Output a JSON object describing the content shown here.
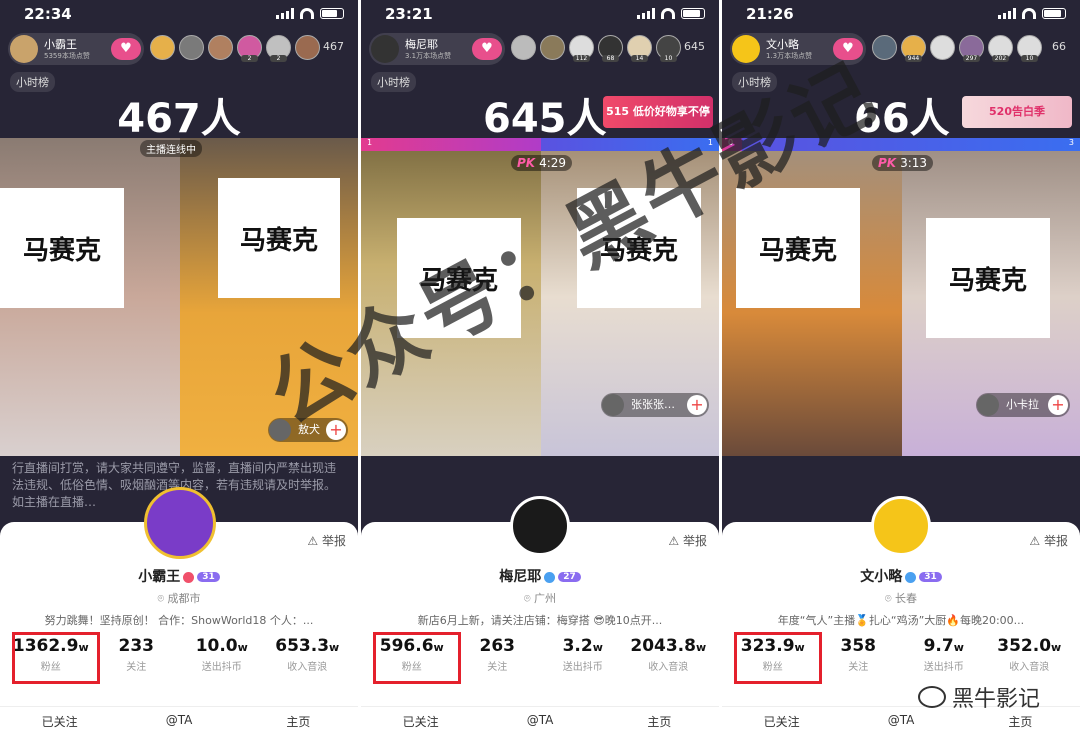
{
  "panels": [
    {
      "time": "22:34",
      "host_name": "小霸王",
      "host_sub": "5359本场点赞",
      "viewer_badges": [
        "",
        "",
        "",
        "2",
        "2",
        ""
      ],
      "viewer_count": "467",
      "rank_label": "小时榜",
      "online": "467人",
      "live_tag": "主播连线中",
      "banner": "",
      "pk_left": "",
      "pk_right": "",
      "pk_time": "",
      "mosaics": [
        "马赛克",
        "马赛克"
      ],
      "guest_name": "敖犬",
      "notice": "行直播间打赏，请大家共同遵守，监督，直播间内严禁出现违法违规、低俗色情、吸烟酗酒等内容，若有违规请及时举报。如主播在直播…",
      "name": "小霸王",
      "level": "31",
      "city": "成都市",
      "bio": "努力跳舞！坚持原创！ 合作：ShowWorld18 个人：...",
      "stats": [
        {
          "num": "1362.9",
          "unit": "w",
          "label": "粉丝"
        },
        {
          "num": "233",
          "unit": "",
          "label": "关注"
        },
        {
          "num": "10.0",
          "unit": "w",
          "label": "送出抖币"
        },
        {
          "num": "653.3",
          "unit": "w",
          "label": "收入音浪"
        }
      ],
      "actions": [
        "已关注",
        "@TA",
        "主页"
      ],
      "report": "举报"
    },
    {
      "time": "23:21",
      "host_name": "梅尼耶",
      "host_sub": "3.1万本场点赞",
      "viewer_badges": [
        "",
        "",
        "112",
        "68",
        "14",
        "10"
      ],
      "viewer_count": "645",
      "rank_label": "小时榜",
      "online": "645人",
      "live_tag": "",
      "banner": "515 低价好物享不停",
      "pk_left": "1",
      "pk_right": "1",
      "pk_time": "4:29",
      "mosaics": [
        "马赛克",
        "马赛克"
      ],
      "guest_name": "张张张…",
      "notice": "",
      "name": "梅尼耶",
      "level": "27",
      "city": "广州",
      "bio": "新店6月上新，请关注店铺：梅穿搭 😎晚10点开...",
      "stats": [
        {
          "num": "596.6",
          "unit": "w",
          "label": "粉丝"
        },
        {
          "num": "263",
          "unit": "",
          "label": "关注"
        },
        {
          "num": "3.2",
          "unit": "w",
          "label": "送出抖币"
        },
        {
          "num": "2043.8",
          "unit": "w",
          "label": "收入音浪"
        }
      ],
      "actions": [
        "已关注",
        "@TA",
        "主页"
      ],
      "report": "举报"
    },
    {
      "time": "21:26",
      "host_name": "文小略",
      "host_sub": "1.3万本场点赞",
      "viewer_badges": [
        "",
        "944",
        "",
        "297",
        "202",
        "10"
      ],
      "viewer_count": "66",
      "rank_label": "小时榜",
      "online": "66人",
      "live_tag": "",
      "banner": "520告白季",
      "pk_left": "0",
      "pk_right": "3",
      "pk_time": "3:13",
      "mosaics": [
        "马赛克",
        "马赛克"
      ],
      "guest_name": "小卡拉",
      "notice": "",
      "name": "文小略",
      "level": "31",
      "city": "长春",
      "bio": "年度“气人”主播🏅扎心“鸡汤”大厨🔥每晚20:00...",
      "stats": [
        {
          "num": "323.9",
          "unit": "w",
          "label": "粉丝"
        },
        {
          "num": "358",
          "unit": "",
          "label": "关注"
        },
        {
          "num": "9.7",
          "unit": "w",
          "label": "送出抖币"
        },
        {
          "num": "352.0",
          "unit": "w",
          "label": "收入音浪"
        }
      ],
      "actions": [
        "已关注",
        "@TA",
        "主页"
      ],
      "report": "举报"
    }
  ],
  "watermark": "公众号：黑牛影记",
  "signature": "黑牛影记",
  "colors": {
    "highlight": "#e4202c",
    "accent": "#e84f8c",
    "level": "#8a6cf0"
  }
}
